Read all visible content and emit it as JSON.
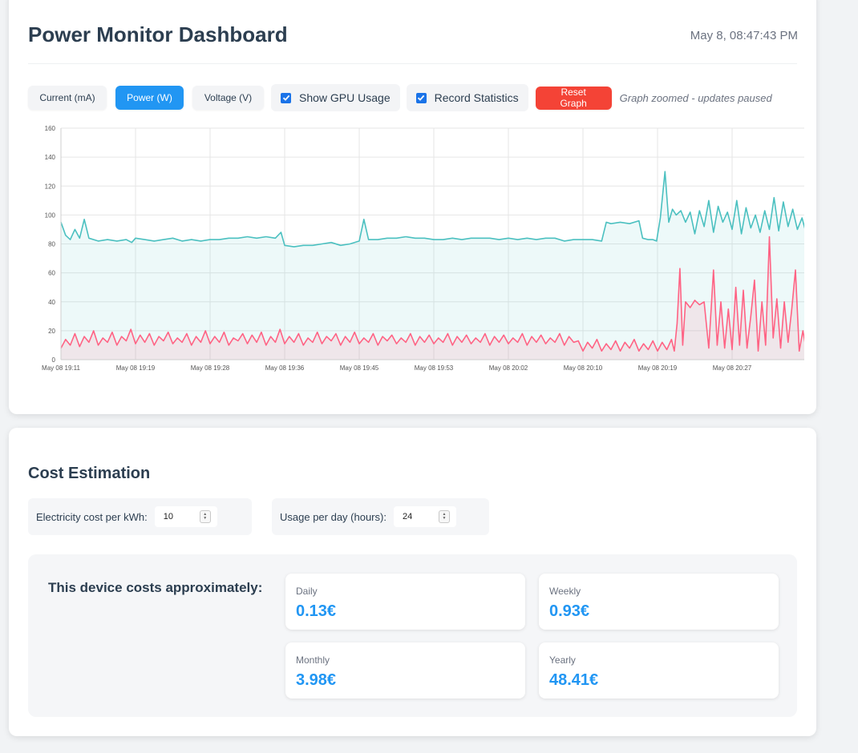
{
  "header": {
    "title": "Power Monitor Dashboard",
    "timestamp": "May 8, 08:47:43 PM"
  },
  "controls": {
    "current_label": "Current (mA)",
    "power_label": "Power (W)",
    "voltage_label": "Voltage (V)",
    "active_metric": "Power (W)",
    "gpu_usage_label": "Show GPU Usage",
    "gpu_usage_checked": true,
    "record_stats_label": "Record Statistics",
    "record_stats_checked": true,
    "reset_label": "Reset Graph",
    "status_note": "Graph zoomed - updates paused"
  },
  "colors": {
    "accent": "#2196f3",
    "danger": "#f44336",
    "power_line": "#4bc0c0",
    "gpu_line": "#ff6384"
  },
  "chart_data": {
    "type": "line",
    "ylim": [
      0,
      160
    ],
    "y_ticks": [
      0,
      20,
      40,
      60,
      80,
      100,
      120,
      140,
      160
    ],
    "x_range_minutes": [
      0,
      80
    ],
    "x_ticks": [
      {
        "label": "May 08 19:11",
        "t": 0
      },
      {
        "label": "May 08 19:19",
        "t": 8
      },
      {
        "label": "May 08 19:28",
        "t": 16
      },
      {
        "label": "May 08 19:36",
        "t": 24
      },
      {
        "label": "May 08 19:45",
        "t": 32
      },
      {
        "label": "May 08 19:53",
        "t": 40
      },
      {
        "label": "May 08 20:02",
        "t": 48
      },
      {
        "label": "May 08 20:10",
        "t": 56
      },
      {
        "label": "May 08 20:19",
        "t": 64
      },
      {
        "label": "May 08 20:27",
        "t": 72
      }
    ],
    "grid": true,
    "legend": "none",
    "series": [
      {
        "color": "#4bc0c0",
        "fill": true,
        "points": [
          [
            0,
            95
          ],
          [
            0.5,
            86
          ],
          [
            1,
            83
          ],
          [
            1.5,
            90
          ],
          [
            2,
            84
          ],
          [
            2.5,
            97
          ],
          [
            3,
            84
          ],
          [
            4,
            82
          ],
          [
            5,
            83
          ],
          [
            6,
            82
          ],
          [
            7,
            83
          ],
          [
            7.6,
            81
          ],
          [
            8,
            84
          ],
          [
            9,
            83
          ],
          [
            10,
            82
          ],
          [
            11,
            83
          ],
          [
            12,
            84
          ],
          [
            13,
            82
          ],
          [
            14,
            83
          ],
          [
            15,
            82
          ],
          [
            16,
            83
          ],
          [
            17,
            83
          ],
          [
            18,
            84
          ],
          [
            19,
            84
          ],
          [
            20,
            85
          ],
          [
            21,
            84
          ],
          [
            22,
            85
          ],
          [
            23,
            84
          ],
          [
            23.6,
            88
          ],
          [
            24,
            79
          ],
          [
            25,
            78
          ],
          [
            26,
            79
          ],
          [
            27,
            79
          ],
          [
            28,
            80
          ],
          [
            29,
            81
          ],
          [
            30,
            79
          ],
          [
            31,
            80
          ],
          [
            32,
            82
          ],
          [
            32.5,
            97
          ],
          [
            33,
            83
          ],
          [
            34,
            83
          ],
          [
            35,
            84
          ],
          [
            36,
            84
          ],
          [
            37,
            85
          ],
          [
            38,
            84
          ],
          [
            39,
            84
          ],
          [
            40,
            83
          ],
          [
            41,
            83
          ],
          [
            42,
            84
          ],
          [
            43,
            83
          ],
          [
            44,
            84
          ],
          [
            45,
            84
          ],
          [
            46,
            84
          ],
          [
            47,
            83
          ],
          [
            48,
            84
          ],
          [
            49,
            83
          ],
          [
            50,
            84
          ],
          [
            51,
            83
          ],
          [
            52,
            84
          ],
          [
            53,
            84
          ],
          [
            54,
            82
          ],
          [
            55,
            83
          ],
          [
            56,
            83
          ],
          [
            57,
            83
          ],
          [
            58,
            82
          ],
          [
            58.5,
            95
          ],
          [
            59,
            94
          ],
          [
            60,
            95
          ],
          [
            61,
            94
          ],
          [
            62,
            96
          ],
          [
            62.4,
            84
          ],
          [
            63,
            83
          ],
          [
            63.5,
            83
          ],
          [
            63.9,
            82
          ],
          [
            64.3,
            98
          ],
          [
            64.8,
            130
          ],
          [
            65.2,
            95
          ],
          [
            65.6,
            104
          ],
          [
            66,
            100
          ],
          [
            66.5,
            103
          ],
          [
            67,
            95
          ],
          [
            67.5,
            102
          ],
          [
            68,
            87
          ],
          [
            68.5,
            103
          ],
          [
            69,
            92
          ],
          [
            69.5,
            110
          ],
          [
            70,
            88
          ],
          [
            70.5,
            106
          ],
          [
            71,
            95
          ],
          [
            71.5,
            102
          ],
          [
            72,
            90
          ],
          [
            72.5,
            110
          ],
          [
            73,
            87
          ],
          [
            73.5,
            105
          ],
          [
            74,
            91
          ],
          [
            74.5,
            100
          ],
          [
            75,
            88
          ],
          [
            75.5,
            103
          ],
          [
            76,
            90
          ],
          [
            76.5,
            112
          ],
          [
            77,
            89
          ],
          [
            77.5,
            109
          ],
          [
            78,
            92
          ],
          [
            78.5,
            104
          ],
          [
            79,
            90
          ],
          [
            79.5,
            98
          ],
          [
            80,
            86
          ]
        ]
      },
      {
        "color": "#ff6384",
        "fill": true,
        "points": [
          [
            0,
            8
          ],
          [
            0.5,
            14
          ],
          [
            1,
            10
          ],
          [
            1.5,
            18
          ],
          [
            2,
            9
          ],
          [
            2.5,
            16
          ],
          [
            3,
            12
          ],
          [
            3.5,
            20
          ],
          [
            4,
            10
          ],
          [
            4.5,
            15
          ],
          [
            5,
            12
          ],
          [
            5.5,
            19
          ],
          [
            6,
            10
          ],
          [
            6.5,
            16
          ],
          [
            7,
            13
          ],
          [
            7.5,
            21
          ],
          [
            8,
            11
          ],
          [
            8.5,
            17
          ],
          [
            9,
            12
          ],
          [
            9.5,
            18
          ],
          [
            10,
            10
          ],
          [
            10.5,
            16
          ],
          [
            11,
            13
          ],
          [
            11.5,
            19
          ],
          [
            12,
            11
          ],
          [
            12.5,
            15
          ],
          [
            13,
            12
          ],
          [
            13.5,
            18
          ],
          [
            14,
            10
          ],
          [
            14.5,
            16
          ],
          [
            15,
            12
          ],
          [
            15.5,
            20
          ],
          [
            16,
            11
          ],
          [
            16.5,
            16
          ],
          [
            17,
            12
          ],
          [
            17.5,
            19
          ],
          [
            18,
            10
          ],
          [
            18.5,
            15
          ],
          [
            19,
            13
          ],
          [
            19.5,
            18
          ],
          [
            20,
            11
          ],
          [
            20.5,
            17
          ],
          [
            21,
            12
          ],
          [
            21.5,
            19
          ],
          [
            22,
            10
          ],
          [
            22.5,
            16
          ],
          [
            23,
            12
          ],
          [
            23.5,
            21
          ],
          [
            24,
            11
          ],
          [
            24.5,
            16
          ],
          [
            25,
            12
          ],
          [
            25.5,
            18
          ],
          [
            26,
            10
          ],
          [
            26.5,
            15
          ],
          [
            27,
            12
          ],
          [
            27.5,
            19
          ],
          [
            28,
            11
          ],
          [
            28.5,
            16
          ],
          [
            29,
            13
          ],
          [
            29.5,
            18
          ],
          [
            30,
            10
          ],
          [
            30.5,
            16
          ],
          [
            31,
            12
          ],
          [
            31.5,
            19
          ],
          [
            32,
            11
          ],
          [
            32.5,
            15
          ],
          [
            33,
            12
          ],
          [
            33.5,
            18
          ],
          [
            34,
            10
          ],
          [
            34.5,
            16
          ],
          [
            35,
            13
          ],
          [
            35.5,
            17
          ],
          [
            36,
            11
          ],
          [
            36.5,
            15
          ],
          [
            37,
            12
          ],
          [
            37.5,
            18
          ],
          [
            38,
            10
          ],
          [
            38.5,
            16
          ],
          [
            39,
            12
          ],
          [
            39.5,
            17
          ],
          [
            40,
            11
          ],
          [
            40.5,
            15
          ],
          [
            41,
            12
          ],
          [
            41.5,
            18
          ],
          [
            42,
            10
          ],
          [
            42.5,
            16
          ],
          [
            43,
            12
          ],
          [
            43.5,
            17
          ],
          [
            44,
            11
          ],
          [
            44.5,
            15
          ],
          [
            45,
            12
          ],
          [
            45.5,
            18
          ],
          [
            46,
            10
          ],
          [
            46.5,
            16
          ],
          [
            47,
            12
          ],
          [
            47.5,
            17
          ],
          [
            48,
            11
          ],
          [
            48.5,
            15
          ],
          [
            49,
            12
          ],
          [
            49.5,
            18
          ],
          [
            50,
            10
          ],
          [
            50.5,
            16
          ],
          [
            51,
            12
          ],
          [
            51.5,
            17
          ],
          [
            52,
            11
          ],
          [
            52.5,
            15
          ],
          [
            53,
            12
          ],
          [
            53.5,
            18
          ],
          [
            54,
            10
          ],
          [
            54.5,
            16
          ],
          [
            55,
            12
          ],
          [
            55.5,
            13
          ],
          [
            56,
            6
          ],
          [
            56.5,
            12
          ],
          [
            57,
            8
          ],
          [
            57.5,
            14
          ],
          [
            58,
            6
          ],
          [
            58.5,
            11
          ],
          [
            59,
            7
          ],
          [
            59.5,
            13
          ],
          [
            60,
            6
          ],
          [
            60.5,
            12
          ],
          [
            61,
            8
          ],
          [
            61.5,
            14
          ],
          [
            62,
            6
          ],
          [
            62.5,
            11
          ],
          [
            63,
            7
          ],
          [
            63.5,
            13
          ],
          [
            64,
            6
          ],
          [
            64.5,
            12
          ],
          [
            65,
            7
          ],
          [
            65.5,
            14
          ],
          [
            65.8,
            6
          ],
          [
            66.1,
            25
          ],
          [
            66.4,
            63
          ],
          [
            66.7,
            10
          ],
          [
            67,
            40
          ],
          [
            67.5,
            36
          ],
          [
            68,
            41
          ],
          [
            68.5,
            38
          ],
          [
            69,
            40
          ],
          [
            69.5,
            8
          ],
          [
            70,
            62
          ],
          [
            70.4,
            10
          ],
          [
            70.8,
            40
          ],
          [
            71.2,
            8
          ],
          [
            71.6,
            35
          ],
          [
            72,
            7
          ],
          [
            72.4,
            50
          ],
          [
            72.8,
            10
          ],
          [
            73.2,
            48
          ],
          [
            73.6,
            8
          ],
          [
            74,
            30
          ],
          [
            74.4,
            55
          ],
          [
            74.8,
            6
          ],
          [
            75.2,
            40
          ],
          [
            75.6,
            10
          ],
          [
            76,
            85
          ],
          [
            76.4,
            15
          ],
          [
            76.8,
            42
          ],
          [
            77.2,
            8
          ],
          [
            77.6,
            40
          ],
          [
            78,
            12
          ],
          [
            78.4,
            35
          ],
          [
            78.8,
            62
          ],
          [
            79.2,
            6
          ],
          [
            79.6,
            20
          ],
          [
            80,
            5
          ]
        ]
      }
    ]
  },
  "cost": {
    "title": "Cost Estimation",
    "kwh_label": "Electricity cost per kWh:",
    "kwh_value": "10",
    "hours_label": "Usage per day (hours):",
    "hours_value": "24",
    "panel_heading": "This device costs approximately:",
    "daily_label": "Daily",
    "daily_value": "0.13€",
    "weekly_label": "Weekly",
    "weekly_value": "0.93€",
    "monthly_label": "Monthly",
    "monthly_value": "3.98€",
    "yearly_label": "Yearly",
    "yearly_value": "48.41€"
  }
}
